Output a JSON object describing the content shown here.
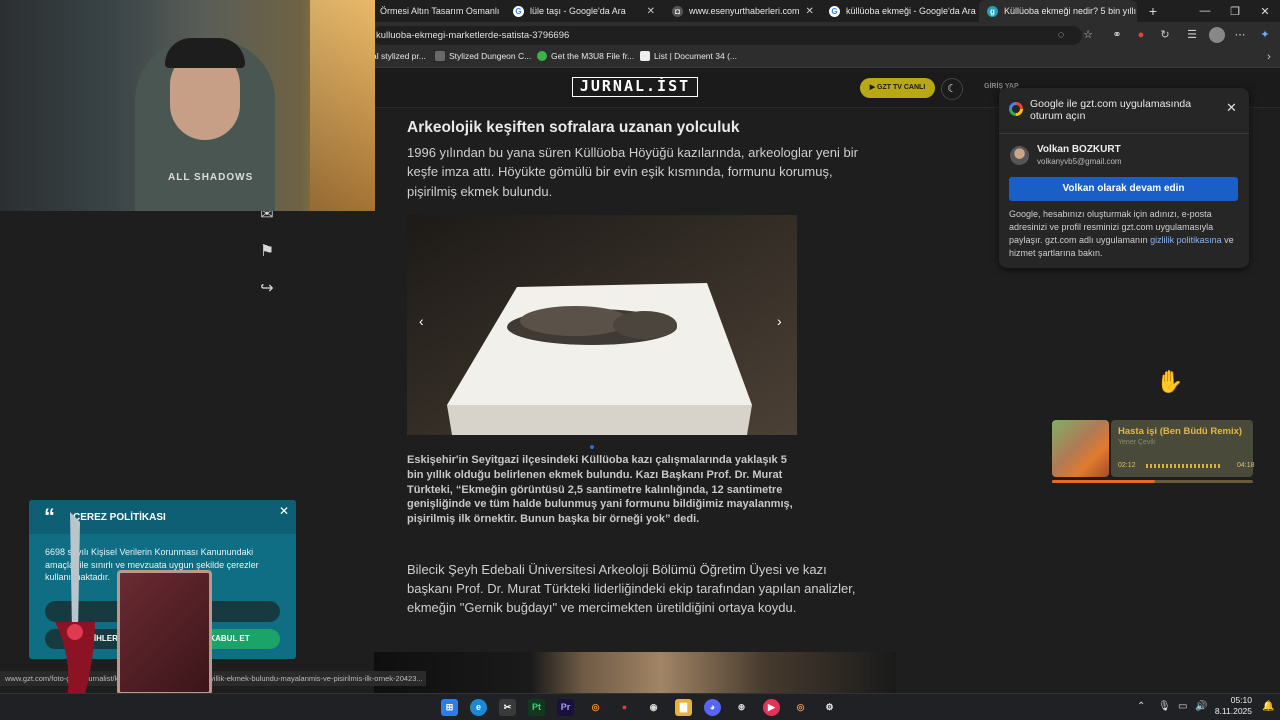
{
  "browser": {
    "tabs": [
      {
        "label": "Örmesi Altın Tasarım Osmanlı"
      },
      {
        "label": "lüle taşı - Google'da Ara"
      },
      {
        "label": "www.esenyurthaberleri.com"
      },
      {
        "label": "küllüoba ekmeği - Google'da Ara"
      },
      {
        "label": "Küllüoba ekmeği nedir? 5 bin yıllı"
      }
    ],
    "url": "kulluoba-ekmegi-marketlerde-satista-3796696",
    "bookmarks": [
      {
        "label": "al stylized pr..."
      },
      {
        "label": "Stylized Dungeon C..."
      },
      {
        "label": "Get the M3U8 File fr..."
      },
      {
        "label": "List | Document 34 (..."
      }
    ]
  },
  "site": {
    "logo": "JURNAL.İST",
    "gzt_button": "GZT TV CANLI",
    "login": "GİRİŞ YAP"
  },
  "article": {
    "heading": "Arkeolojik keşiften sofralara uzanan yolculuk",
    "lead": "1996 yılından bu yana süren Küllüoba Höyüğü kazılarında, arkeologlar yeni bir keşfe imza attı. Höyükte gömülü bir evin eşik kısmında, formunu korumuş, pişirilmiş ekmek bulundu.",
    "caption": "Eskişehir'in Seyitgazi ilçesindeki Küllüoba kazı çalışmalarında yaklaşık 5 bin yıllık olduğu belirlenen ekmek bulundu. Kazı Başkanı Prof. Dr. Murat Türkteki, “Ekmeğin görüntüsü 2,5 santimetre kalınlığında, 12 santimetre genişliğinde ve tüm halde bulunmuş yani formunu bildiğimiz mayalanmış, pişirilmiş ilk örnektir. Bunun başka bir örneği yok” dedi.",
    "paragraph": "Bilecik Şeyh Edebali Üniversitesi Arkeoloji Bölümü Öğretim Üyesi ve kazı başkanı Prof. Dr. Murat Türkteki liderliğindeki ekip tarafından yapılan analizler, ekmeğin \"Gernik buğdayı\" ve mercimekten üretildiğini ortaya koydu."
  },
  "google_popup": {
    "title": "Google ile gzt.com uygulamasında oturum açın",
    "user_name": "Volkan BOZKURT",
    "user_email": "volkanyvb5@gmail.com",
    "continue_label": "Volkan olarak devam edin",
    "info_prefix": "Google, hesabınızı oluşturmak için adınızı, e-posta adresinizi ve profil resminizi gzt.com uygulamasıyla paylaşır. gzt.com adlı uygulamanın ",
    "info_link": "gizlilik politikasına",
    "info_suffix": " ve hizmet şartlarına bakın."
  },
  "music": {
    "song": "Hasta işi (Ben Büdü Remix)",
    "artist": "Yener Çevik",
    "time_current": "02:12",
    "time_total": "04:18",
    "progress": 0.51
  },
  "cookie": {
    "title": "ÇEREZ POLİTİKASI",
    "text": "6698 sayılı Kişisel Verilerin Korunması Kanunundaki amaçlar ile sınırlı ve mevzuata uygun şekilde çerezler kullanılmaktadır.",
    "btn_prefs": "TERCİHLER",
    "btn_accept": "KABUL ET"
  },
  "status_url": "www.gzt.com/foto-galeri/jurnalist/kulluoba-ekmegi-nedir-5-bin-yillik-ekmek-bulundu-mayalanmis-ve-pisirilmis-ilk-ornek-20423...",
  "webcam": {
    "shirt_text": "ALL SHADOWS"
  },
  "taskbar": {
    "time": "05:10",
    "date": "8.11.2025"
  }
}
